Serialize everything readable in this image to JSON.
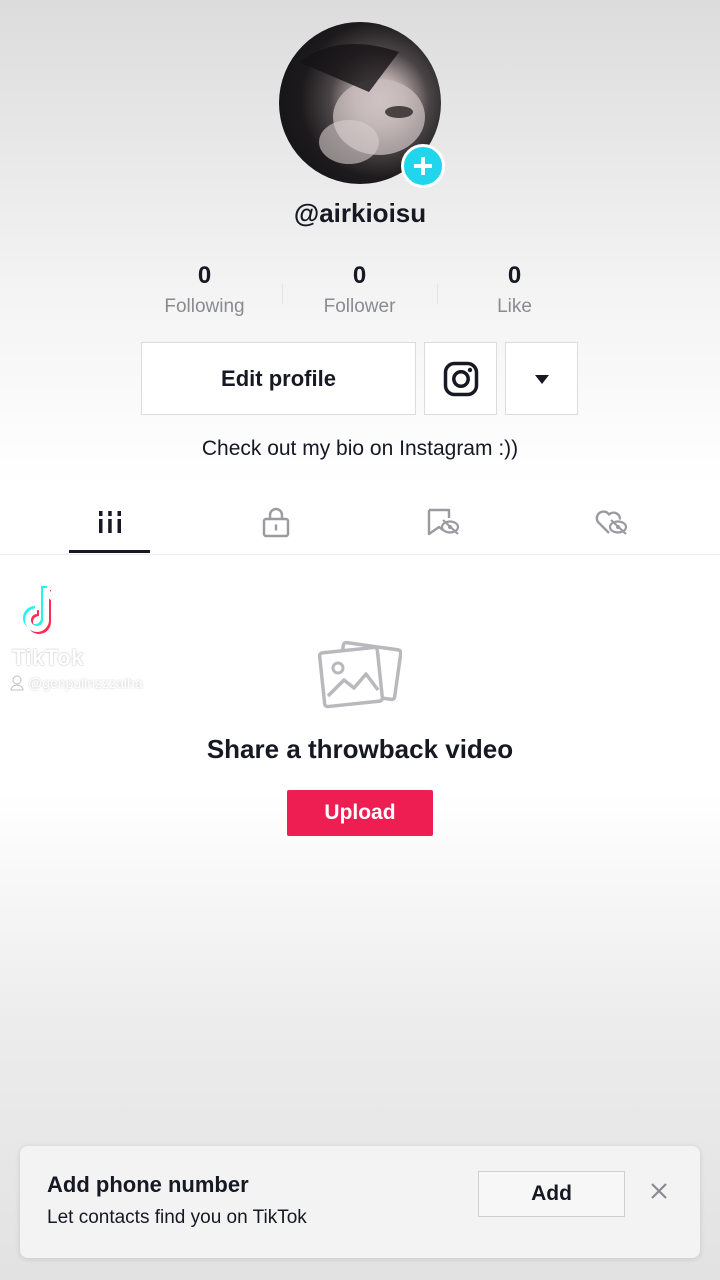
{
  "profile": {
    "username": "@airkioisu",
    "bio": "Check out my bio on Instagram :))"
  },
  "stats": [
    {
      "value": "0",
      "label": "Following"
    },
    {
      "value": "0",
      "label": "Follower"
    },
    {
      "value": "0",
      "label": "Like"
    }
  ],
  "buttons": {
    "edit_profile": "Edit profile",
    "instagram_icon": "instagram-icon",
    "more_icon": "caret-down-icon"
  },
  "tabs": [
    {
      "icon": "grid-icon",
      "active": true
    },
    {
      "icon": "lock-icon",
      "active": false
    },
    {
      "icon": "bookmark-hidden-icon",
      "active": false
    },
    {
      "icon": "heart-hidden-icon",
      "active": false
    }
  ],
  "watermark": {
    "brand": "TikTok",
    "user": "@genpuiinzzzaiha"
  },
  "empty_state": {
    "icon": "photos-icon",
    "title": "Share a throwback video",
    "button": "Upload"
  },
  "banner": {
    "title": "Add phone number",
    "subtitle": "Let contacts find you on TikTok",
    "add_label": "Add",
    "close_icon": "close-icon"
  },
  "colors": {
    "accent": "#ee1d52",
    "avatar_plus": "#20d5ec",
    "text": "#161823",
    "muted": "#8a8b91"
  }
}
